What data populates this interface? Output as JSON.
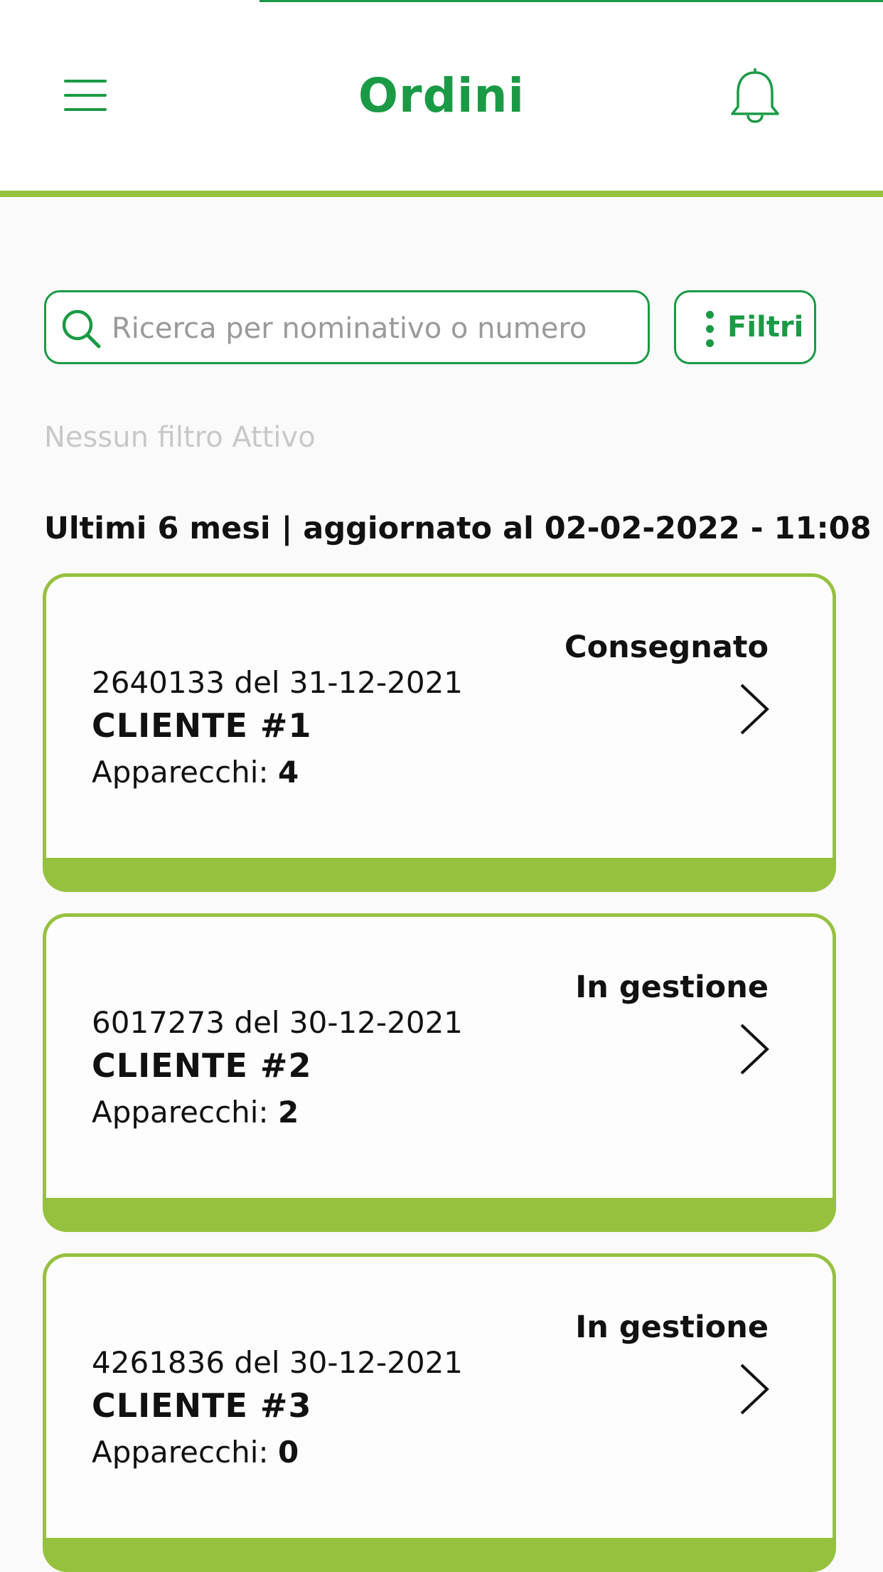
{
  "header": {
    "title": "Ordini",
    "menu_icon": "hamburger-menu-icon",
    "bell_icon": "bell-icon"
  },
  "search": {
    "placeholder": "Ricerca per nominativo o numero",
    "value": ""
  },
  "filter": {
    "label": "Filtri",
    "icon": "kebab-icon"
  },
  "no_filter_text": "Nessun filtro Attivo",
  "updated_text": "Ultimi 6 mesi | aggiornato al 02-02-2022 - 11:08",
  "devices_label": "Apparecchi: ",
  "orders": [
    {
      "number": "2640133 del 31-12-2021",
      "client": "CLIENTE #1",
      "devices": "4",
      "status": "Consegnato"
    },
    {
      "number": "6017273 del 30-12-2021",
      "client": "CLIENTE #2",
      "devices": "2",
      "status": "In gestione"
    },
    {
      "number": "4261836 del 30-12-2021",
      "client": "CLIENTE #3",
      "devices": "0",
      "status": "In gestione"
    }
  ],
  "colors": {
    "primary_green": "#1a9a45",
    "accent_lime": "#96c13e"
  }
}
